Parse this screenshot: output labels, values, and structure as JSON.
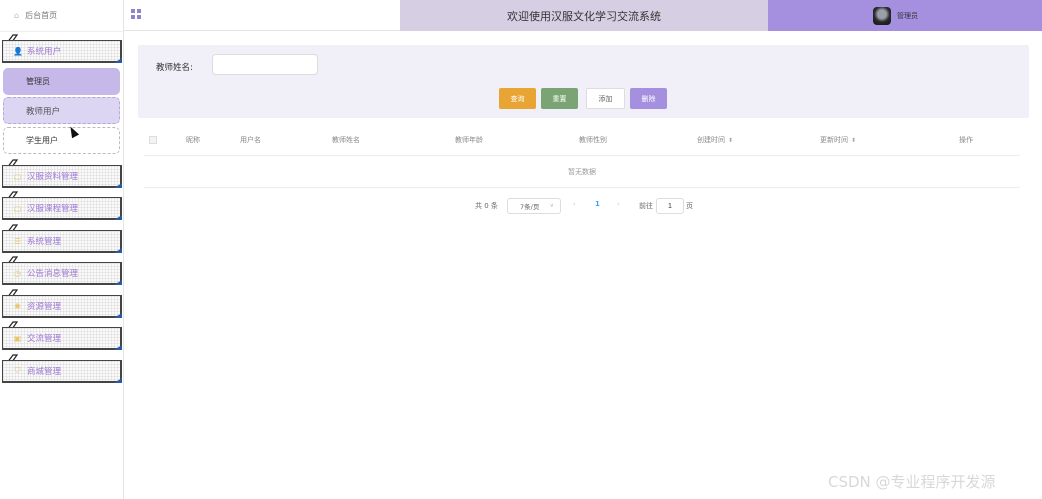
{
  "sidebar": {
    "home_label": "后台首页",
    "menus": [
      {
        "label": "系统用户",
        "icon": "user-icon",
        "glyph": "👤"
      },
      {
        "label": "汉服资料管理",
        "icon": "document-icon",
        "glyph": "▢"
      },
      {
        "label": "汉服课程管理",
        "icon": "document-icon",
        "glyph": "▢"
      },
      {
        "label": "系统管理",
        "icon": "list-icon",
        "glyph": "☰"
      },
      {
        "label": "公告消息管理",
        "icon": "clock-icon",
        "glyph": "◷"
      },
      {
        "label": "资源管理",
        "icon": "gear-icon",
        "glyph": "✺"
      },
      {
        "label": "交流管理",
        "icon": "chat-icon",
        "glyph": "▣"
      },
      {
        "label": "商城管理",
        "icon": "cart-icon",
        "glyph": "⛉"
      }
    ],
    "submenus": [
      {
        "label": "管理员"
      },
      {
        "label": "教师用户"
      },
      {
        "label": "学生用户"
      }
    ]
  },
  "header": {
    "title": "欢迎使用汉服文化学习交流系统",
    "user_name": "管理员"
  },
  "search": {
    "label": "教师姓名:",
    "value": "",
    "placeholder": ""
  },
  "buttons": {
    "query": "查询",
    "reset": "重置",
    "add": "添加",
    "delete": "删除"
  },
  "table": {
    "columns": [
      "昵称",
      "用户名",
      "教师姓名",
      "教师年龄",
      "教师性别",
      "创建时间",
      "更新时间",
      "操作"
    ],
    "empty_text": "暂无数据"
  },
  "pagination": {
    "total": "共 0 条",
    "page_size": "7条/页",
    "prev": "‹",
    "current_page": "1",
    "next": "›",
    "goto_label": "前往",
    "goto_value": "1",
    "page_unit": "页"
  },
  "watermark": "CSDN @专业程序开发源",
  "colors": {
    "accent": "#a590e0",
    "title_bar": "#d6cfe3",
    "panel": "#f1eff8",
    "query": "#e9a534",
    "reset": "#7aa474"
  }
}
